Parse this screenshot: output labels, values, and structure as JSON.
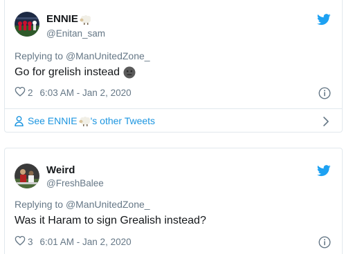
{
  "tweets": [
    {
      "name": "ENNIE",
      "name_emoji": "sheep-emoji",
      "handle": "@Enitan_sam",
      "replying_prefix": "Replying to ",
      "replying_handle": "@ManUnitedZone_",
      "text": "Go for grelish instead",
      "text_emoji": "neutral-face-emoji",
      "like_count": "2",
      "timestamp": "6:03 AM - Jan 2, 2020",
      "see_more_prefix": "See ENNIE",
      "see_more_suffix": "'s other Tweets"
    },
    {
      "name": "Weird",
      "handle": "@FreshBalee",
      "replying_prefix": "Replying to ",
      "replying_handle": "@ManUnitedZone_",
      "text": "Was it Haram to sign Grealish instead?",
      "like_count": "3",
      "timestamp": "6:01 AM - Jan 2, 2020"
    }
  ],
  "colors": {
    "twitter_blue": "#1da1f2",
    "link_blue": "#1b95e0",
    "secondary_text": "#657786",
    "primary_text": "#14171a",
    "border": "#e1e8ed"
  },
  "icons": {
    "platform": "twitter-bird-icon",
    "like": "heart-outline-icon",
    "info": "info-circle-icon",
    "profile": "person-outline-icon",
    "chevron": "chevron-right-icon"
  }
}
